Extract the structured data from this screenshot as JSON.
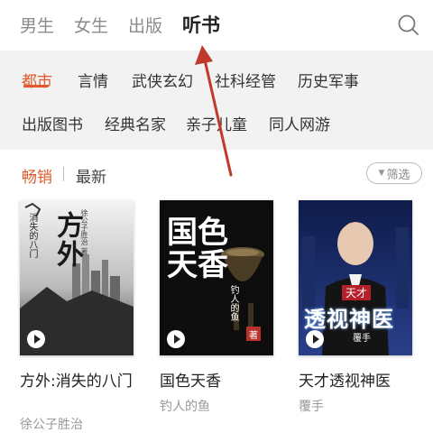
{
  "topnav": {
    "tabs": [
      {
        "label": "男生"
      },
      {
        "label": "女生"
      },
      {
        "label": "出版"
      },
      {
        "label": "听书"
      }
    ],
    "active_index": 3,
    "search_icon": "search-icon"
  },
  "categories": {
    "row1": [
      "都市",
      "言情",
      "武侠玄幻",
      "社科经管",
      "历史军事"
    ],
    "row2": [
      "出版图书",
      "经典名家",
      "亲子儿童",
      "同人网游"
    ],
    "active": "都市"
  },
  "sort": {
    "hot": "畅销",
    "latest": "最新",
    "filter": "筛选"
  },
  "books": [
    {
      "title": "方外:消失的八门",
      "author": "徐公子胜治",
      "cover_text": "方外",
      "cover_subtitle": "消失的八门",
      "cover_author": "徐公子胜治 著"
    },
    {
      "title": "国色天香",
      "author": "钓人的鱼",
      "cover_text": "国色天香",
      "cover_author": "钓人的鱼",
      "cover_badge": "著"
    },
    {
      "title": "天才透视神医",
      "author": "覆手",
      "cover_tag": "天才",
      "cover_text": "透视神医",
      "cover_author": "覆手"
    }
  ],
  "colors": {
    "accent": "#e05a2b",
    "panel_bg": "#f2f2f2",
    "annotation_arrow": "#c0392b"
  }
}
